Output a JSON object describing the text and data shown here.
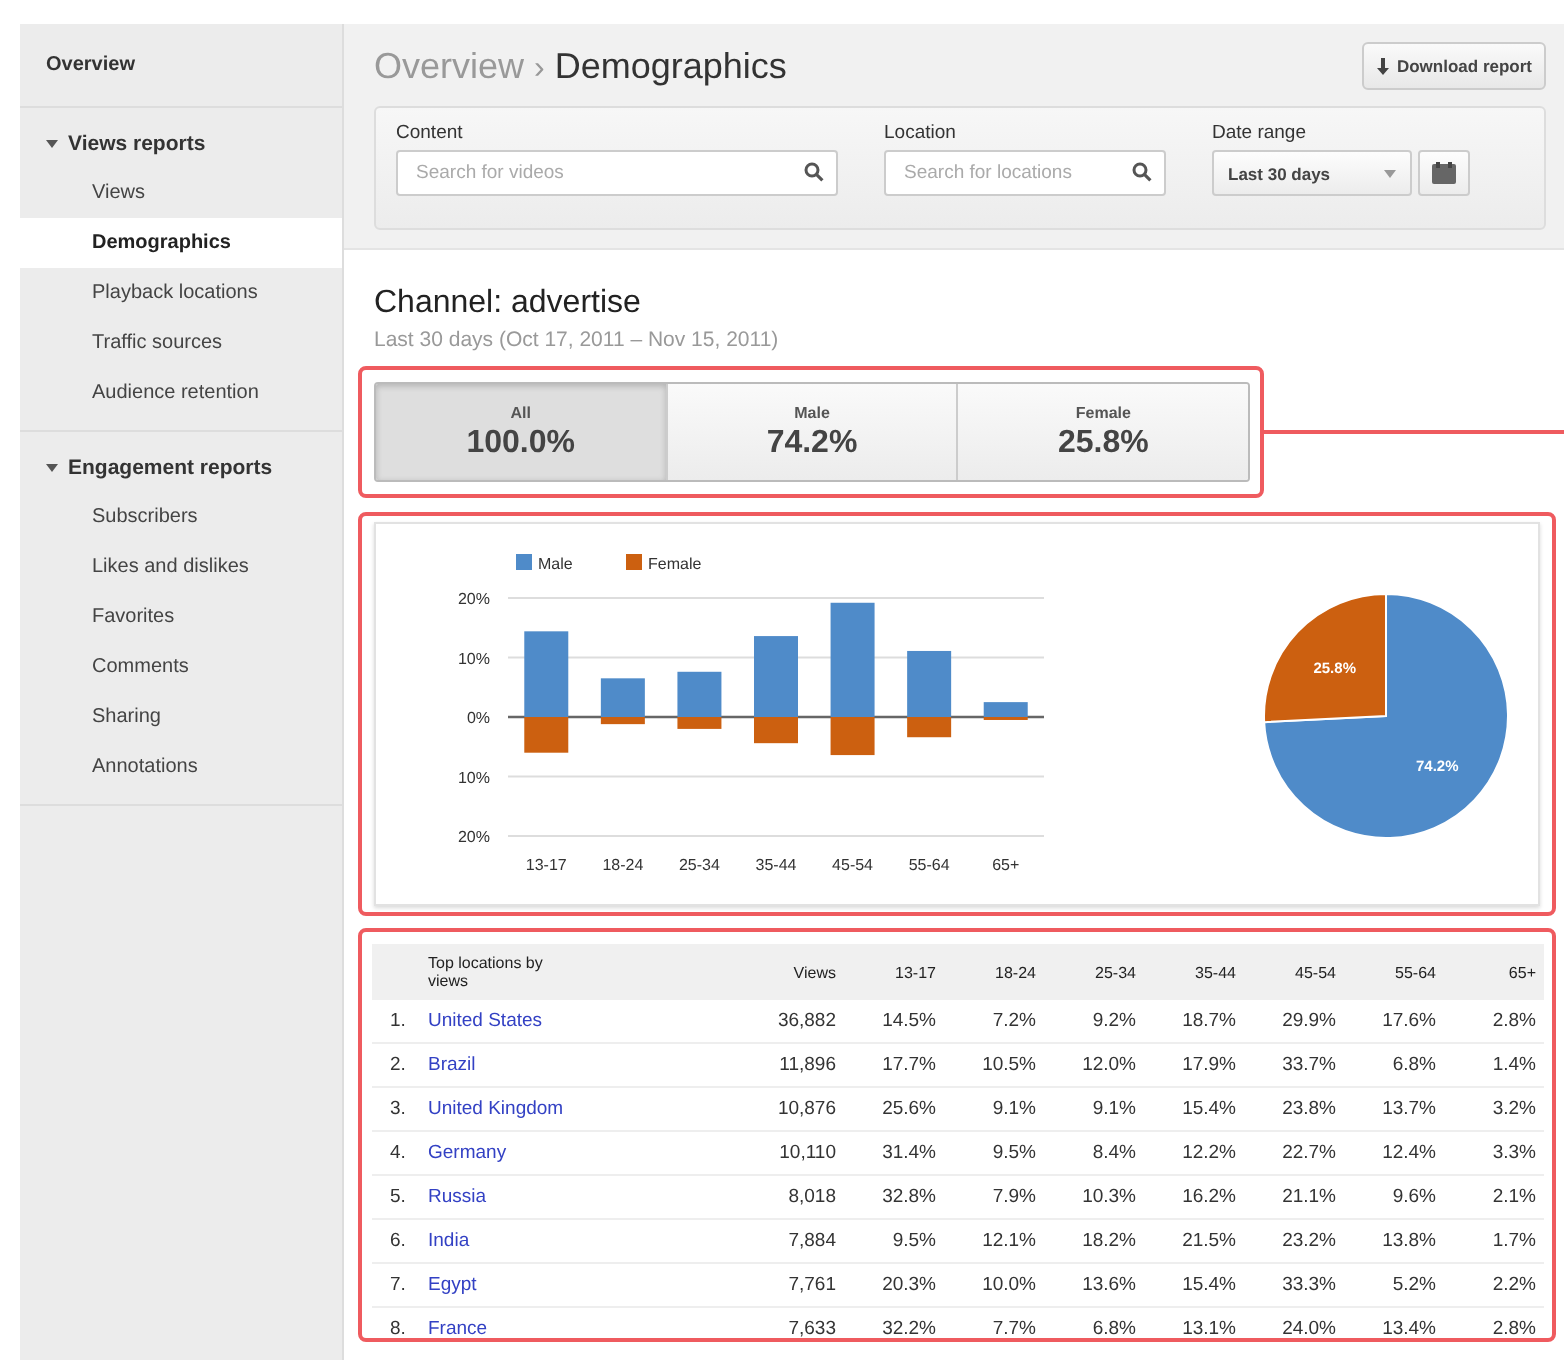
{
  "sidebar": {
    "overview": {
      "label": "Overview",
      "selected": false
    },
    "groups": [
      {
        "label": "Views reports",
        "expanded": true,
        "children": [
          {
            "label": "Views",
            "selected": false
          },
          {
            "label": "Demographics",
            "selected": true
          },
          {
            "label": "Playback locations",
            "selected": false
          },
          {
            "label": "Traffic sources",
            "selected": false
          },
          {
            "label": "Audience retention",
            "selected": false
          }
        ]
      },
      {
        "label": "Engagement reports",
        "expanded": true,
        "children": [
          {
            "label": "Subscribers",
            "selected": false
          },
          {
            "label": "Likes and dislikes",
            "selected": false
          },
          {
            "label": "Favorites",
            "selected": false
          },
          {
            "label": "Comments",
            "selected": false
          },
          {
            "label": "Sharing",
            "selected": false
          },
          {
            "label": "Annotations",
            "selected": false
          }
        ]
      }
    ]
  },
  "header": {
    "breadcrumb": {
      "parent": "Overview",
      "separator": "›",
      "current": "Demographics"
    },
    "download_button": "Download report",
    "filters": {
      "content": {
        "label": "Content",
        "placeholder": "Search for videos"
      },
      "location": {
        "label": "Location",
        "placeholder": "Search for locations"
      },
      "date_range": {
        "label": "Date range",
        "value": "Last 30 days"
      }
    }
  },
  "summary": {
    "title": "Channel: advertise",
    "subtitle": "Last 30 days (Oct 17, 2011 – Nov 15, 2011)",
    "segments": [
      {
        "label": "All",
        "value": "100.0%",
        "selected": true
      },
      {
        "label": "Male",
        "value": "74.2%",
        "selected": false
      },
      {
        "label": "Female",
        "value": "25.8%",
        "selected": false
      }
    ]
  },
  "bar_chart": {
    "chart_data": {
      "type": "bar",
      "categories": [
        "13-17",
        "18-24",
        "25-34",
        "35-44",
        "45-54",
        "55-64",
        "65+"
      ],
      "series": [
        {
          "name": "Male",
          "color": "#4f8bc9",
          "values": [
            14.4,
            6.5,
            7.6,
            13.6,
            19.2,
            11.1,
            2.5
          ]
        },
        {
          "name": "Female",
          "color": "#cc6010",
          "values": [
            -6.0,
            -1.2,
            -2.0,
            -4.4,
            -6.4,
            -3.4,
            -0.5
          ]
        }
      ],
      "stacked": true,
      "legend": true,
      "ylim": [
        -20,
        20
      ],
      "yticks": [
        {
          "value": 20,
          "label": "20%"
        },
        {
          "value": 10,
          "label": "10%"
        },
        {
          "value": 0,
          "label": "0%"
        },
        {
          "value": -10,
          "label": "10%"
        },
        {
          "value": -20,
          "label": "20%"
        }
      ]
    }
  },
  "pie_chart": {
    "chart_data": {
      "type": "pie",
      "values": [
        74.2,
        25.8
      ],
      "colors": [
        "#4f8bc9",
        "#cc6010"
      ],
      "value_labels": [
        "74.2%",
        "25.8%"
      ]
    }
  },
  "locations_table": {
    "columns": [
      "",
      "Top locations by views",
      "Views",
      "13-17",
      "18-24",
      "25-34",
      "35-44",
      "45-54",
      "55-64",
      "65+"
    ],
    "rows": [
      {
        "cells": [
          "1.",
          "United States",
          "36,882",
          "14.5%",
          "7.2%",
          "9.2%",
          "18.7%",
          "29.9%",
          "17.6%",
          "2.8%"
        ]
      },
      {
        "cells": [
          "2.",
          "Brazil",
          "11,896",
          "17.7%",
          "10.5%",
          "12.0%",
          "17.9%",
          "33.7%",
          "6.8%",
          "1.4%"
        ]
      },
      {
        "cells": [
          "3.",
          "United Kingdom",
          "10,876",
          "25.6%",
          "9.1%",
          "9.1%",
          "15.4%",
          "23.8%",
          "13.7%",
          "3.2%"
        ]
      },
      {
        "cells": [
          "4.",
          "Germany",
          "10,110",
          "31.4%",
          "9.5%",
          "8.4%",
          "12.2%",
          "22.7%",
          "12.4%",
          "3.3%"
        ]
      },
      {
        "cells": [
          "5.",
          "Russia",
          "8,018",
          "32.8%",
          "7.9%",
          "10.3%",
          "16.2%",
          "21.1%",
          "9.6%",
          "2.1%"
        ]
      },
      {
        "cells": [
          "6.",
          "India",
          "7,884",
          "9.5%",
          "12.1%",
          "18.2%",
          "21.5%",
          "23.2%",
          "13.8%",
          "1.7%"
        ]
      },
      {
        "cells": [
          "7.",
          "Egypt",
          "7,761",
          "20.3%",
          "10.0%",
          "13.6%",
          "15.4%",
          "33.3%",
          "5.2%",
          "2.2%"
        ]
      },
      {
        "cells": [
          "8.",
          "France",
          "7,633",
          "32.2%",
          "7.7%",
          "6.8%",
          "13.1%",
          "24.0%",
          "13.4%",
          "2.8%"
        ]
      }
    ]
  }
}
